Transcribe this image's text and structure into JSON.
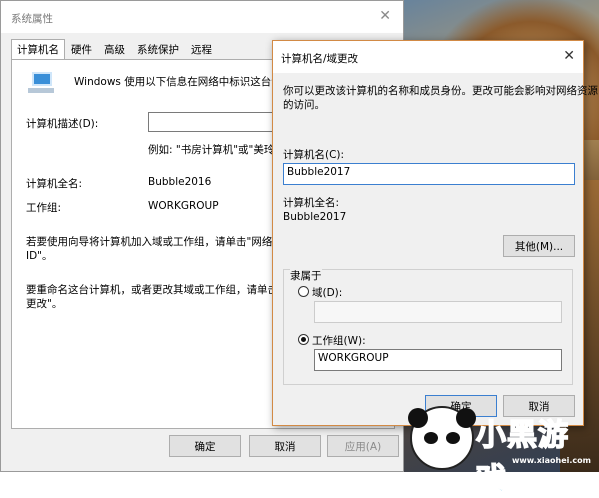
{
  "main_window": {
    "title": "系统属性",
    "close_glyph": "✕",
    "tabs": [
      "计算机名",
      "硬件",
      "高级",
      "系统保护",
      "远程"
    ],
    "intro": "Windows 使用以下信息在网络中标识这台计",
    "desc_label": "计算机描述(D):",
    "desc_value": "",
    "desc_example": "例如: \"书房计算机\"或\"美玲的",
    "fullname_label": "计算机全名:",
    "fullname_value": "Bubble2016",
    "workgroup_label": "工作组:",
    "workgroup_value": "WORKGROUP",
    "network_id_text_1": "若要使用向导将计算机加入域或工作组，请单击\"网络",
    "network_id_text_2": "ID\"。",
    "rename_text_1": "要重命名这台计算机，或者更改其域或工作组，请单击\"",
    "rename_text_2": "更改\"。",
    "ok": "确定",
    "cancel": "取消",
    "apply": "应用(A)"
  },
  "dialog": {
    "title": "计算机名/域更改",
    "close_glyph": "✕",
    "info_1": "你可以更改该计算机的名称和成员身份。更改可能会影响对网络资源",
    "info_2": "的访问。",
    "name_label": "计算机名(C):",
    "name_value": "Bubble2017",
    "fullname_label": "计算机全名:",
    "fullname_value": "Bubble2017",
    "other_button": "其他(M)...",
    "member_of": "隶属于",
    "domain_label": "域(D):",
    "domain_value": "",
    "workgroup_label": "工作组(W):",
    "workgroup_value": "WORKGROUP",
    "selected_option": "workgroup",
    "ok": "确定",
    "cancel": "取消"
  },
  "watermark": {
    "brand": "小黑游戏",
    "url": "www.xiaohei.com"
  },
  "colors": {
    "dialog_border": "#d28a45",
    "brand": "#1c9ad6"
  }
}
